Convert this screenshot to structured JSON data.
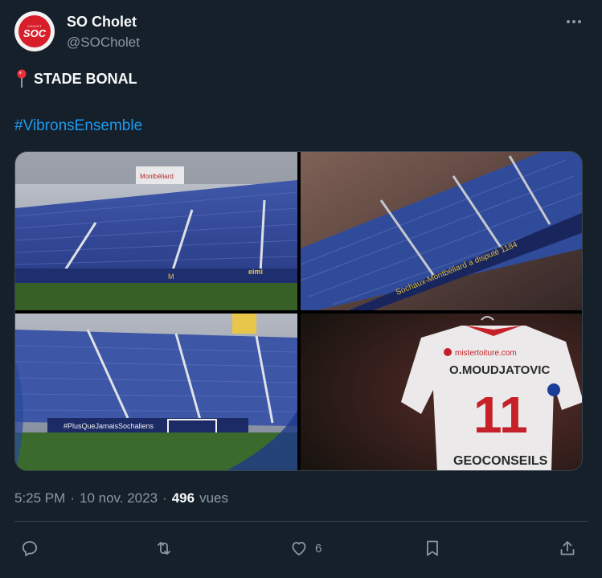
{
  "account": {
    "display_name": "SO Cholet",
    "handle": "@SOCholet",
    "avatar_text": "SOC",
    "avatar_subtext": "CHOLET"
  },
  "tweet": {
    "pin_icon": "round-pushpin-emoji",
    "location_text": "STADE BONAL",
    "hashtag": "#VibronsEnsemble"
  },
  "media": {
    "banner_1": "Montbéliard",
    "banner_2": "Sochaux-Montbéliard a disputé 1184",
    "banner_3": "#PlusQueJamaisSochaliens",
    "jersey_sponsor": "mistertoiture.com",
    "jersey_name": "O.MOUDJATOVIC",
    "jersey_number": "11",
    "jersey_sponsor_2": "GEOCONSEILS"
  },
  "meta": {
    "time": "5:25 PM",
    "separator": "·",
    "date": "10 nov. 2023",
    "views_count": "496",
    "views_label": "vues"
  },
  "actions": {
    "reply_count": "",
    "retweet_count": "",
    "like_count": "6",
    "bookmark_count": ""
  },
  "colors": {
    "background": "#15202b",
    "link": "#1d9bf0",
    "secondary_text": "#8b98a5",
    "brand_red": "#d81e2a"
  }
}
